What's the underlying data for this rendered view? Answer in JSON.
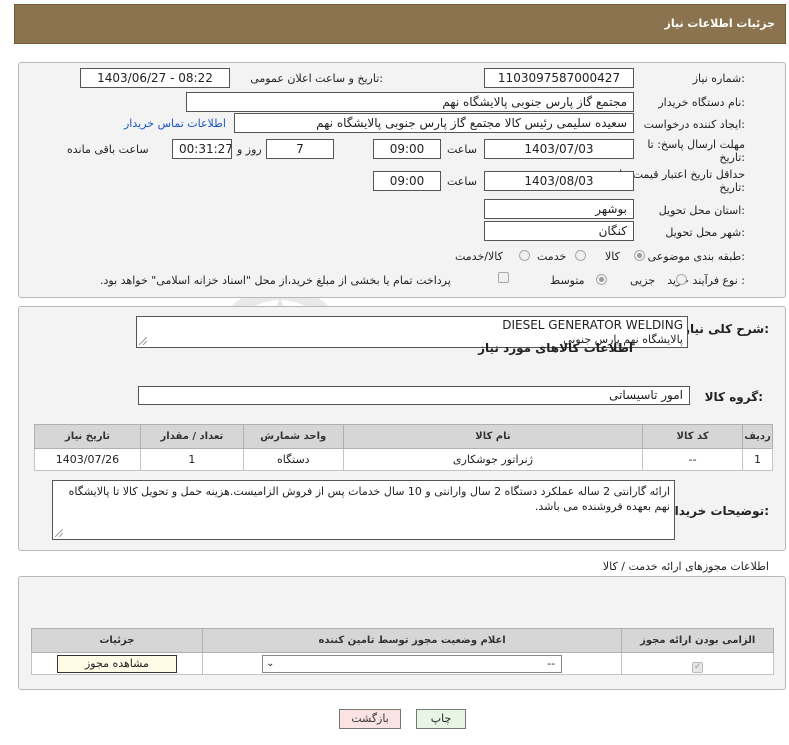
{
  "header": {
    "title": "جزئیات اطلاعات نیاز"
  },
  "form": {
    "need_number_label": "شماره نیاز:",
    "need_number": "1103097587000427",
    "announce_label": "تاریخ و ساعت اعلان عمومی:",
    "announce_value": "1403/06/27 - 08:22",
    "buyer_org_label": "نام دستگاه خریدار:",
    "buyer_org": "مجتمع گاز پارس جنوبی  پالایشگاه نهم",
    "requester_label": "ایجاد کننده درخواست:",
    "requester": "سعیده سلیمی رئیس کالا مجتمع گاز پارس جنوبی  پالایشگاه نهم",
    "buyer_contact_link": "اطلاعات تماس خریدار",
    "deadline_label": "مهلت ارسال پاسخ: تا تاریخ:",
    "deadline_date": "1403/07/03",
    "time_label": "ساعت",
    "deadline_time": "09:00",
    "days_value": "7",
    "days_label": "روز و",
    "remaining_time": "00:31:27",
    "remaining_label": "ساعت باقی مانده",
    "validity_label": "حداقل تاریخ اعتبار قیمت: تا تاریخ:",
    "validity_date": "1403/08/03",
    "validity_time": "09:00",
    "province_label": "استان محل تحویل:",
    "province": "بوشهر",
    "city_label": "شهر محل تحویل:",
    "city": "کنگان",
    "category_label": "طبقه بندی موضوعی:",
    "category_options": [
      "کالا",
      "خدمت",
      "کالا/خدمت"
    ],
    "process_label": "نوع فرآیند خرید :",
    "process_options": [
      "جزیی",
      "متوسط"
    ],
    "process_note": "پرداخت تمام یا بخشی از مبلغ خرید،از محل \"اسناد خزانه اسلامی\" خواهد بود."
  },
  "summary": {
    "label": "شرح کلی نیاز:",
    "line1": "DIESEL GENERATOR WELDING",
    "line2": "پالایشگاه نهم پارس جنوبی"
  },
  "goods": {
    "section_title": "اطلاعات کالاهای مورد نیاز",
    "group_label": "گروه کالا:",
    "group_value": "امور تاسیساتی",
    "columns": [
      "ردیف",
      "کد کالا",
      "نام کالا",
      "واحد شمارش",
      "تعداد / مقدار",
      "تاریخ نیاز"
    ],
    "rows": [
      {
        "row": "1",
        "code": "--",
        "name": "ژنراتور جوشکاری",
        "unit": "دستگاه",
        "qty": "1",
        "date": "1403/07/26"
      }
    ]
  },
  "buyer_notes": {
    "label": "توضیحات خریدار:",
    "text": "ارائه گارانتی 2 ساله  عملکرد دستگاه 2 سال وارانتی و 10 سال خدمات پس از فروش الزامیست.هزینه حمل و تحویل کالا تا پالایشگاه نهم بعهده فروشنده می باشد."
  },
  "permits": {
    "section_title": "اطلاعات مجوزهای ارائه خدمت / کالا",
    "columns": [
      "الزامی بودن ارائه مجوز",
      "اعلام وضعیت مجوز توسط تامین کننده",
      "جزئیات"
    ],
    "select_value": "--",
    "view_button": "مشاهده مجوز"
  },
  "buttons": {
    "print": "چاپ",
    "back": "بازگشت"
  },
  "watermark": {
    "text": "AriaTender.neT"
  },
  "colors": {
    "header_bg": "#8b7350",
    "print_bg": "#e8f5e4",
    "back_bg": "#fbe3e3",
    "link": "#1a55c4"
  }
}
